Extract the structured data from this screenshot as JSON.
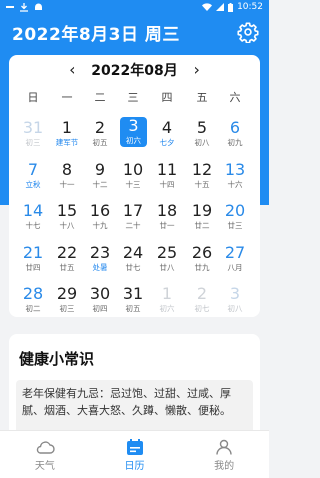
{
  "status": {
    "time": "10:52"
  },
  "header": {
    "date": "2022年8月3日 周三"
  },
  "calendar": {
    "month_title": "2022年08月",
    "prev_arrow": "‹",
    "next_arrow": "›",
    "weekdays": [
      "日",
      "一",
      "二",
      "三",
      "四",
      "五",
      "六"
    ],
    "weeks": [
      [
        {
          "n": "31",
          "s": "初三",
          "t": "dim-weekend"
        },
        {
          "n": "1",
          "s": "建军节",
          "t": "festival"
        },
        {
          "n": "2",
          "s": "初五",
          "t": ""
        },
        {
          "n": "3",
          "s": "初六",
          "t": "selected"
        },
        {
          "n": "4",
          "s": "七夕",
          "t": "festival"
        },
        {
          "n": "5",
          "s": "初八",
          "t": ""
        },
        {
          "n": "6",
          "s": "初九",
          "t": "weekend"
        }
      ],
      [
        {
          "n": "7",
          "s": "立秋",
          "t": "weekend festival"
        },
        {
          "n": "8",
          "s": "十一",
          "t": ""
        },
        {
          "n": "9",
          "s": "十二",
          "t": ""
        },
        {
          "n": "10",
          "s": "十三",
          "t": ""
        },
        {
          "n": "11",
          "s": "十四",
          "t": ""
        },
        {
          "n": "12",
          "s": "十五",
          "t": ""
        },
        {
          "n": "13",
          "s": "十六",
          "t": "weekend"
        }
      ],
      [
        {
          "n": "14",
          "s": "十七",
          "t": "weekend"
        },
        {
          "n": "15",
          "s": "十八",
          "t": ""
        },
        {
          "n": "16",
          "s": "十九",
          "t": ""
        },
        {
          "n": "17",
          "s": "二十",
          "t": ""
        },
        {
          "n": "18",
          "s": "廿一",
          "t": ""
        },
        {
          "n": "19",
          "s": "廿二",
          "t": ""
        },
        {
          "n": "20",
          "s": "廿三",
          "t": "weekend"
        }
      ],
      [
        {
          "n": "21",
          "s": "廿四",
          "t": "weekend"
        },
        {
          "n": "22",
          "s": "廿五",
          "t": ""
        },
        {
          "n": "23",
          "s": "处暑",
          "t": "festival"
        },
        {
          "n": "24",
          "s": "廿七",
          "t": ""
        },
        {
          "n": "25",
          "s": "廿八",
          "t": ""
        },
        {
          "n": "26",
          "s": "廿九",
          "t": ""
        },
        {
          "n": "27",
          "s": "八月",
          "t": "weekend"
        }
      ],
      [
        {
          "n": "28",
          "s": "初二",
          "t": "weekend"
        },
        {
          "n": "29",
          "s": "初三",
          "t": ""
        },
        {
          "n": "30",
          "s": "初四",
          "t": ""
        },
        {
          "n": "31",
          "s": "初五",
          "t": ""
        },
        {
          "n": "1",
          "s": "初六",
          "t": "dim-weekday"
        },
        {
          "n": "2",
          "s": "初七",
          "t": "dim-weekday"
        },
        {
          "n": "3",
          "s": "初八",
          "t": "dim-weekend"
        }
      ]
    ]
  },
  "health": {
    "title": "健康小常识",
    "text": "老年保健有九忌：忌过饱、过甜、过咸、厚腻、烟酒、大喜大怒、久蹲、懒散、便秘。"
  },
  "tabs": [
    {
      "label": "天气",
      "icon": "cloud-icon",
      "active": false
    },
    {
      "label": "日历",
      "icon": "calendar-icon",
      "active": true
    },
    {
      "label": "我的",
      "icon": "person-icon",
      "active": false
    }
  ],
  "colors": {
    "accent": "#1f8cf2",
    "weekend": "#2a8ae8"
  }
}
